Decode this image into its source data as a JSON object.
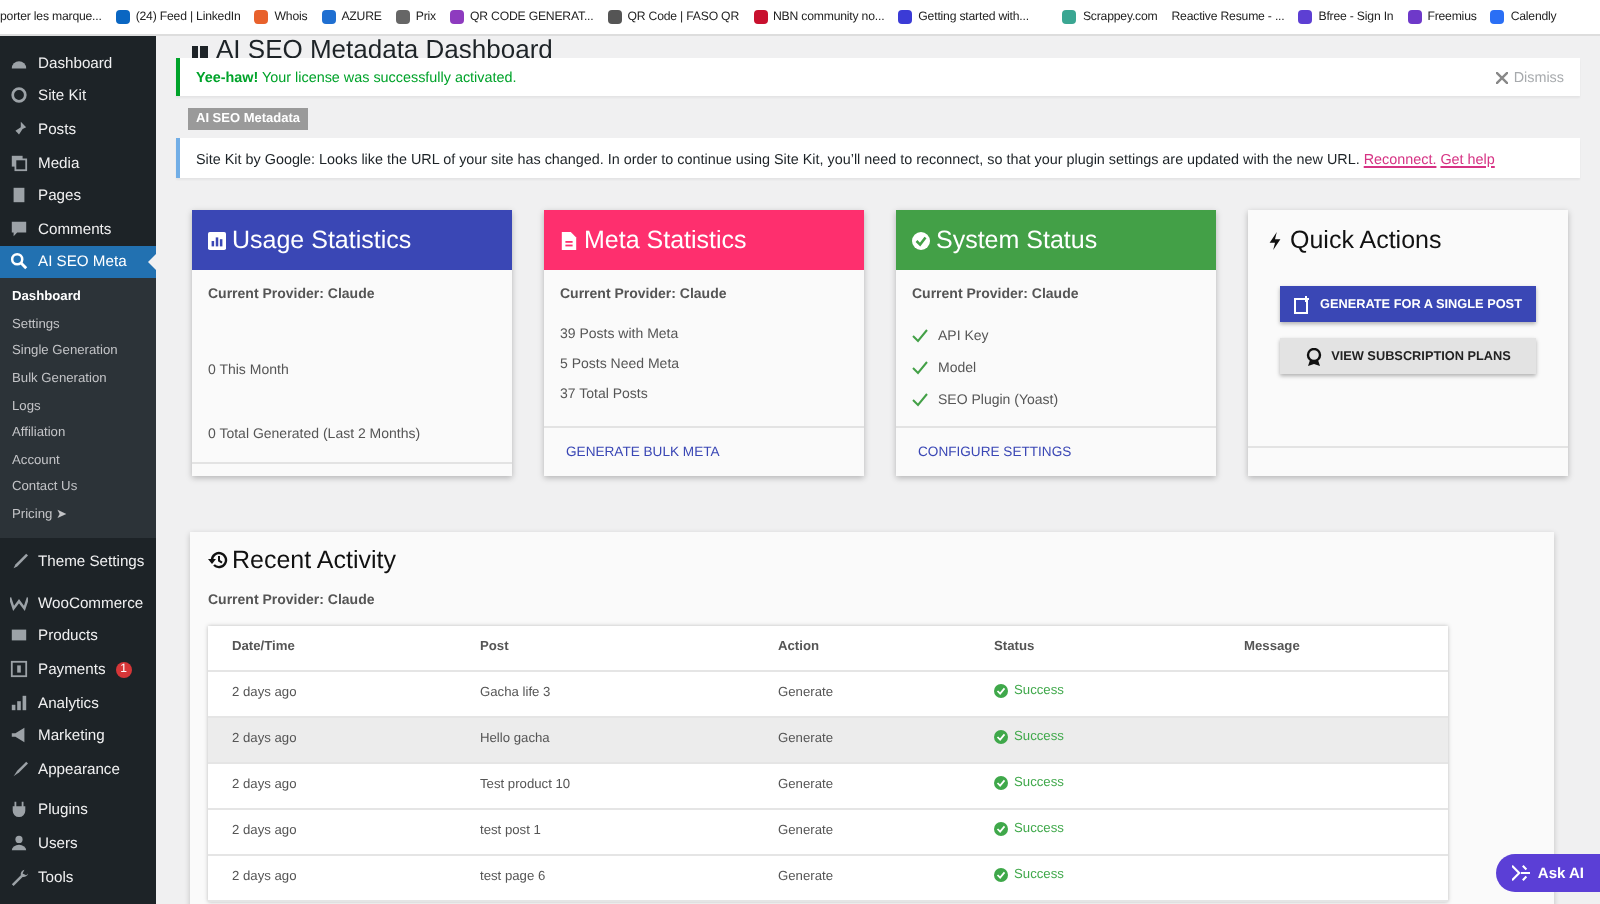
{
  "bookmarks": [
    {
      "label": "porter les marque..."
    },
    {
      "label": "(24) Feed | LinkedIn",
      "color": "#0a66c2"
    },
    {
      "label": "Whois",
      "color": "#e8612c"
    },
    {
      "label": "AZURE",
      "color": "#1f6fd1"
    },
    {
      "label": "Prix",
      "color": "#666666"
    },
    {
      "label": "QR CODE GENERAT...",
      "color": "#8e3bbf"
    },
    {
      "label": "QR Code | FASO QR",
      "color": "#555555"
    },
    {
      "label": "NBN community no...",
      "color": "#c8102e"
    },
    {
      "label": "Getting started with...",
      "color": "#3b3bd6"
    },
    {
      "label": "Scrappey.com",
      "color": "#3aa692"
    },
    {
      "label": "Reactive Resume - ..."
    },
    {
      "label": "Bfree - Sign In",
      "color": "#5d3fd3"
    },
    {
      "label": "Freemius",
      "color": "#6e39c9"
    },
    {
      "label": "Calendly",
      "color": "#2a6ff5"
    }
  ],
  "sidebar": {
    "items": [
      {
        "label": "Dashboard",
        "selected": false
      },
      {
        "label": "Site Kit",
        "selected": false
      },
      {
        "label": "Posts",
        "selected": false
      },
      {
        "label": "Media",
        "selected": false
      },
      {
        "label": "Pages",
        "selected": false
      },
      {
        "label": "Comments",
        "selected": false
      },
      {
        "label": "AI SEO Meta",
        "selected": true,
        "children": [
          {
            "label": "Dashboard",
            "selected": true
          },
          {
            "label": "Settings",
            "selected": false
          },
          {
            "label": "Single Generation",
            "selected": false
          },
          {
            "label": "Bulk Generation",
            "selected": false
          },
          {
            "label": "Logs",
            "selected": false
          },
          {
            "label": "Affiliation",
            "selected": false
          },
          {
            "label": "Account",
            "selected": false
          },
          {
            "label": "Contact Us",
            "selected": false
          },
          {
            "label": "Pricing ➤",
            "selected": false
          }
        ]
      },
      {
        "label": "Theme Settings",
        "selected": false
      },
      {
        "label": "WooCommerce",
        "selected": false
      },
      {
        "label": "Products",
        "selected": false
      },
      {
        "label": "Payments",
        "selected": false,
        "badge": "1"
      },
      {
        "label": "Analytics",
        "selected": false
      },
      {
        "label": "Marketing",
        "selected": false
      },
      {
        "label": "Appearance",
        "selected": false
      },
      {
        "label": "Plugins",
        "selected": false
      },
      {
        "label": "Users",
        "selected": false
      },
      {
        "label": "Tools",
        "selected": false
      }
    ]
  },
  "page": {
    "title": "AI SEO Metadata Dashboard"
  },
  "notices": [
    {
      "kind": "success",
      "strong": "Yee-haw!",
      "text": "Your license was successfully activated.",
      "dismiss": "Dismiss"
    },
    {
      "kind": "tag",
      "text": "AI SEO Metadata"
    },
    {
      "kind": "info",
      "text": "Site Kit by Google: Looks like the URL of your site has changed. In order to continue using Site Kit, you’ll need to reconnect, so that your plugin settings are updated with the new URL.",
      "links": [
        "Reconnect.",
        "Get help"
      ]
    }
  ],
  "cards": [
    {
      "kind": "usage",
      "title": "Usage Statistics",
      "color": "#3a47b5",
      "provider": "Current Provider: Claude",
      "lines": [
        "0 This Month",
        "0 Total Generated (Last 2 Months)"
      ]
    },
    {
      "kind": "meta",
      "title": "Meta Statistics",
      "color": "#fe2f6e",
      "provider": "Current Provider: Claude",
      "lines": [
        "39 Posts with Meta",
        "5 Posts Need Meta",
        "37 Total Posts"
      ],
      "link": "GENERATE BULK META"
    },
    {
      "kind": "status",
      "title": "System Status",
      "color": "#43a047",
      "provider": "Current Provider: Claude",
      "checks": [
        {
          "label": "API Key",
          "checked": true
        },
        {
          "label": "Model",
          "checked": true
        },
        {
          "label": "SEO Plugin (Yoast)",
          "checked": true
        }
      ],
      "link": "CONFIGURE SETTINGS"
    },
    {
      "kind": "actions",
      "title": "Quick Actions",
      "buttons": [
        {
          "kind": "primary",
          "label": "GENERATE FOR A SINGLE POST"
        },
        {
          "kind": "secondary",
          "label": "VIEW SUBSCRIPTION PLANS"
        }
      ]
    }
  ],
  "activity": {
    "title": "Recent Activity",
    "provider": "Current Provider: Claude",
    "table": {
      "columns": [
        "Date/Time",
        "Post",
        "Action",
        "Status",
        "Message"
      ],
      "rows": [
        {
          "time": "2 days ago",
          "post": "Gacha life 3",
          "action": "Generate",
          "status": "Success",
          "kind": "success",
          "selected": false
        },
        {
          "time": "2 days ago",
          "post": "Hello gacha",
          "action": "Generate",
          "status": "Success",
          "kind": "success",
          "selected": true
        },
        {
          "time": "2 days ago",
          "post": "Test product 10",
          "action": "Generate",
          "status": "Success",
          "kind": "success",
          "selected": false
        },
        {
          "time": "2 days ago",
          "post": "test post 1",
          "action": "Generate",
          "status": "Success",
          "kind": "success",
          "selected": false
        },
        {
          "time": "2 days ago",
          "post": "test page 6",
          "action": "Generate",
          "status": "Success",
          "kind": "success",
          "selected": false
        }
      ]
    }
  },
  "assistant": {
    "label": "Ask AI"
  }
}
